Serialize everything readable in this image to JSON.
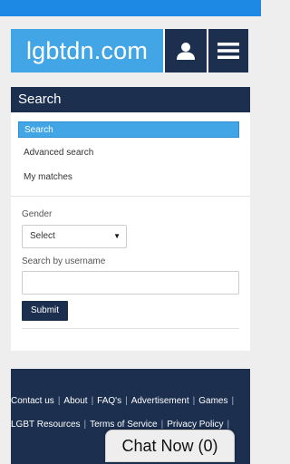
{
  "header": {
    "logo_text": "lgbtdn.com",
    "user_icon": "user-icon",
    "menu_icon": "hamburger-icon"
  },
  "search_panel": {
    "title": "Search",
    "menu_items": [
      {
        "label": "Search",
        "active": true
      },
      {
        "label": "Advanced search",
        "active": false
      },
      {
        "label": "My matches",
        "active": false
      }
    ],
    "gender_label": "Gender",
    "gender_select_value": "Select",
    "username_label": "Search by username",
    "username_value": "",
    "submit_label": "Submit"
  },
  "footer": {
    "links_row1": [
      "Contact us",
      "About",
      "FAQ's",
      "Advertisement",
      "Games"
    ],
    "links_row2": [
      "LGBT Resources",
      "Terms of Service",
      "Privacy Policy"
    ]
  },
  "chat": {
    "label": "Chat Now (0)"
  },
  "colors": {
    "status_bar": "#1e88e5",
    "navy": "#1c2f4f",
    "accent": "#42a5e5"
  }
}
